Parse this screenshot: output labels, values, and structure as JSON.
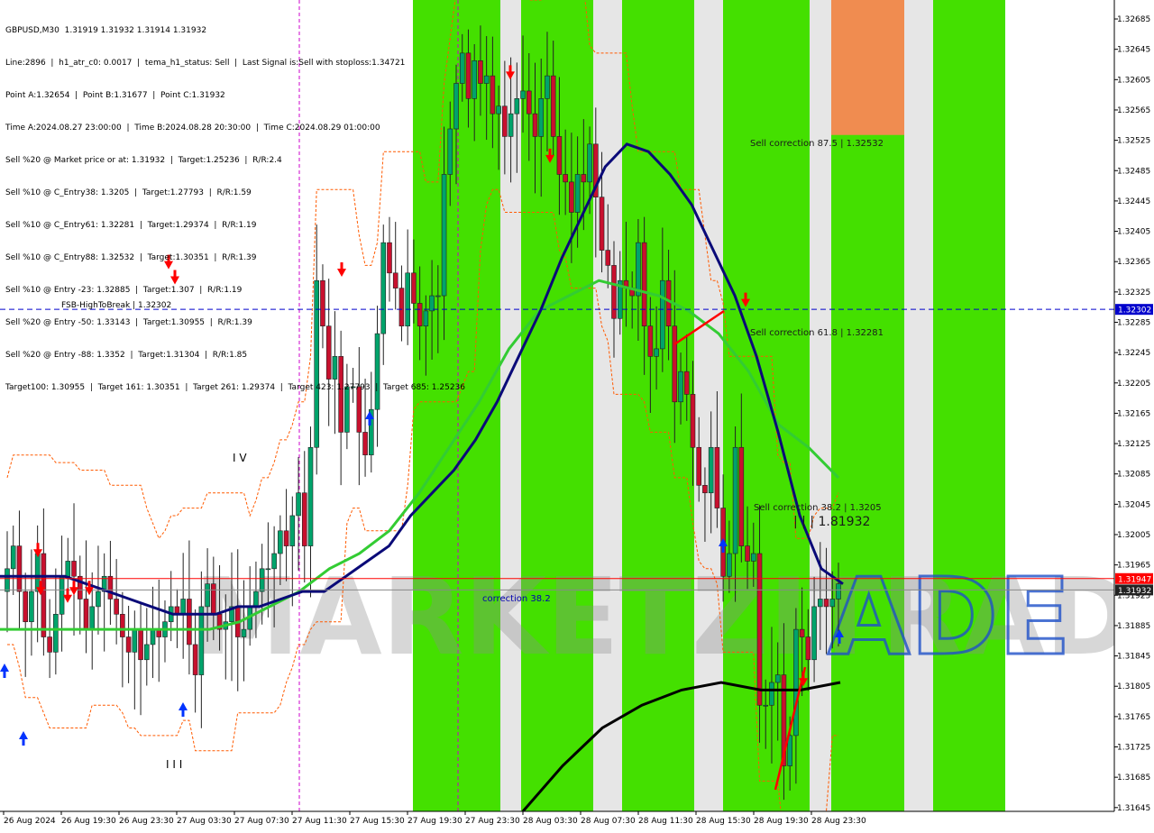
{
  "header": {
    "symbol_line": "GBPUSD,M30  1.31919 1.31932 1.31914 1.31932",
    "info_lines": [
      "Line:2896  |  h1_atr_c0: 0.0017  |  tema_h1_status: Sell  |  Last Signal is:Sell with stoploss:1.34721",
      "Point A:1.32654  |  Point B:1.31677  |  Point C:1.31932",
      "Time A:2024.08.27 23:00:00  |  Time B:2024.08.28 20:30:00  |  Time C:2024.08.29 01:00:00",
      "Sell %20 @ Market price or at: 1.31932  |  Target:1.25236  |  R/R:2.4",
      "Sell %10 @ C_Entry38: 1.3205  |  Target:1.27793  |  R/R:1.59",
      "Sell %10 @ C_Entry61: 1.32281  |  Target:1.29374  |  R/R:1.19",
      "Sell %10 @ C_Entry88: 1.32532  |  Target:1.30351  |  R/R:1.39",
      "Sell %10 @ Entry -23: 1.32885  |  Target:1.307  |  R/R:1.19",
      "Sell %20 @ Entry -50: 1.33143  |  Target:1.30955  |  R/R:1.39",
      "Sell %20 @ Entry -88: 1.3352  |  Target:1.31304  |  R/R:1.85",
      "Target100: 1.30955  |  Target 161: 1.30351  |  Target 261: 1.29374  |  Target 423: 1.27793  |  Target 685: 1.25236"
    ]
  },
  "annotations": {
    "fsb_label": "FSB-HighToBreak  |  1.32302",
    "sell_correction_875": "Sell correction 87.5 | 1.32532",
    "sell_correction_618": "Sell correction 61.8 | 1.32281",
    "sell_correction_382": "Sell correction 38.2 | 1.3205",
    "current_price_note": "| | |  1.81932",
    "correction_382": "correction 38.2",
    "wave_iv": "I V",
    "wave_iii": "I I I",
    "watermark": "MARKETZITRADE"
  },
  "price_tags": {
    "fsb": "1.32302",
    "red_line": "1.31947",
    "current": "1.31932"
  },
  "colors": {
    "bull_candle": "#00a36b",
    "bear_candle": "#c8102e",
    "green_zone": "#44e000",
    "orange_zone": "#f08c50",
    "ma_navy": "#0a0a78",
    "ma_green": "#33cc33",
    "ma_black": "#000000",
    "envelope_orange": "#ff5a00",
    "fsb_line": "#0000cc",
    "red_line": "#ff0000",
    "watermark_blue": "#1e50c8"
  },
  "chart_data": {
    "type": "candlestick",
    "symbol": "GBPUSD",
    "timeframe": "M30",
    "ylim": [
      1.3164,
      1.3271
    ],
    "y_ticks": [
      "1.32685",
      "1.32645",
      "1.32605",
      "1.32565",
      "1.32525",
      "1.32485",
      "1.32445",
      "1.32405",
      "1.32365",
      "1.32325",
      "1.32285",
      "1.32245",
      "1.32205",
      "1.32165",
      "1.32125",
      "1.32085",
      "1.32045",
      "1.32005",
      "1.31965",
      "1.31925",
      "1.31885",
      "1.31845",
      "1.31805",
      "1.31765",
      "1.31725",
      "1.31685",
      "1.31645"
    ],
    "x_tick_labels": [
      "26 Aug 2024",
      "26 Aug 19:30",
      "26 Aug 23:30",
      "27 Aug 03:30",
      "27 Aug 07:30",
      "27 Aug 11:30",
      "27 Aug 15:30",
      "27 Aug 19:30",
      "27 Aug 23:30",
      "28 Aug 03:30",
      "28 Aug 07:30",
      "28 Aug 11:30",
      "28 Aug 15:30",
      "28 Aug 19:30",
      "28 Aug 23:30"
    ],
    "closes": [
      1.3196,
      1.3199,
      1.3193,
      1.3189,
      1.3193,
      1.3198,
      1.3187,
      1.3185,
      1.319,
      1.3195,
      1.3197,
      1.3195,
      1.3192,
      1.3188,
      1.3191,
      1.3193,
      1.3195,
      1.3192,
      1.319,
      1.3187,
      1.3185,
      1.3188,
      1.3184,
      1.3186,
      1.3188,
      1.3187,
      1.3189,
      1.3191,
      1.319,
      1.3192,
      1.3186,
      1.3182,
      1.3191,
      1.3194,
      1.319,
      1.3188,
      1.3189,
      1.3191,
      1.3187,
      1.3188,
      1.3191,
      1.3193,
      1.3196,
      1.3196,
      1.3198,
      1.3201,
      1.3199,
      1.3203,
      1.3206,
      1.3199,
      1.3212,
      1.3234,
      1.3228,
      1.3221,
      1.3224,
      1.3214,
      1.322,
      1.322,
      1.3214,
      1.3211,
      1.3217,
      1.3227,
      1.3239,
      1.3235,
      1.3233,
      1.3228,
      1.3235,
      1.3231,
      1.3228,
      1.323,
      1.3232,
      1.3232,
      1.3248,
      1.3254,
      1.326,
      1.3264,
      1.3258,
      1.3263,
      1.326,
      1.3261,
      1.3256,
      1.3257,
      1.3253,
      1.3256,
      1.3258,
      1.3259,
      1.3256,
      1.3253,
      1.3258,
      1.3261,
      1.3253,
      1.3248,
      1.3247,
      1.3243,
      1.3248,
      1.3247,
      1.3252,
      1.3245,
      1.3238,
      1.3236,
      1.3229,
      1.3234,
      1.3233,
      1.3232,
      1.3239,
      1.3228,
      1.3224,
      1.3225,
      1.3234,
      1.3228,
      1.3218,
      1.3222,
      1.3219,
      1.3212,
      1.3207,
      1.3206,
      1.3212,
      1.3204,
      1.3195,
      1.3198,
      1.3212,
      1.3199,
      1.3197,
      1.3198,
      1.3178,
      1.3178,
      1.3181,
      1.3182,
      1.317,
      1.3174,
      1.3188,
      1.3187,
      1.3184,
      1.3191,
      1.3192,
      1.3191,
      1.3192,
      1.3194
    ],
    "ma_navy": [
      1.3195,
      1.3195,
      1.3195,
      1.3195,
      1.3194,
      1.3193,
      1.3192,
      1.3191,
      1.319,
      1.319,
      1.319,
      1.3191,
      1.3191,
      1.3192,
      1.3193,
      1.3193,
      1.3195,
      1.3197,
      1.3199,
      1.3203,
      1.3206,
      1.3209,
      1.3213,
      1.3218,
      1.3224,
      1.323,
      1.3237,
      1.3243,
      1.3249,
      1.3252,
      1.3251,
      1.3248,
      1.3244,
      1.3238,
      1.3232,
      1.3224,
      1.3214,
      1.3203,
      1.3196,
      1.3194
    ],
    "ma_green": [
      1.3188,
      1.3188,
      1.3188,
      1.3188,
      1.3188,
      1.3188,
      1.3188,
      1.3188,
      1.3189,
      1.3191,
      1.3193,
      1.3196,
      1.3198,
      1.3201,
      1.3206,
      1.3212,
      1.3218,
      1.3225,
      1.323,
      1.3232,
      1.3234,
      1.3233,
      1.3232,
      1.323,
      1.3227,
      1.3222,
      1.3215,
      1.3212,
      1.3208
    ],
    "ma_black": [
      1.3164,
      1.317,
      1.3175,
      1.3178,
      1.318,
      1.3181,
      1.318,
      1.318,
      1.3181
    ],
    "markers": {
      "sell_arrows": 12,
      "buy_arrows": 6
    }
  }
}
